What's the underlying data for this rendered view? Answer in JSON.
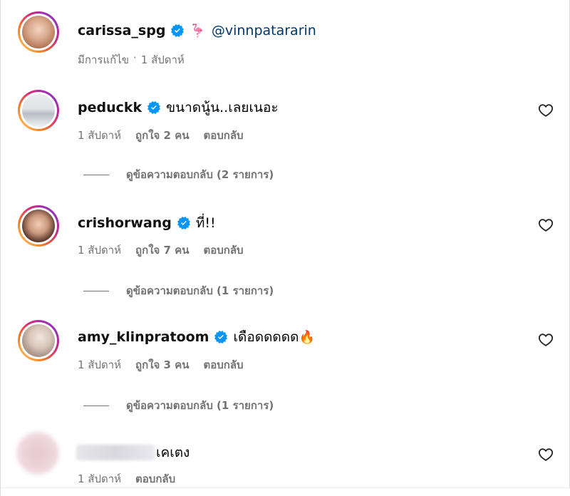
{
  "caption": {
    "username": "carissa_spg",
    "mention": "@vinnpatararin",
    "emoji": "🦩",
    "edited_label": "มีการแก้ไข",
    "separator": "·",
    "time": "1 สัปดาห์"
  },
  "comments": [
    {
      "username": "peduckk",
      "text": "ขนาดนู้น..เลยเนอะ",
      "time": "1 สัปดาห์",
      "likes": "ถูกใจ 2 คน",
      "reply_label": "ตอบกลับ",
      "view_replies": "ดูข้อความตอบกลับ (2 รายการ)"
    },
    {
      "username": "crishorwang",
      "text": "ที่!!",
      "time": "1 สัปดาห์",
      "likes": "ถูกใจ 7 คน",
      "reply_label": "ตอบกลับ",
      "view_replies": "ดูข้อความตอบกลับ (1 รายการ)"
    },
    {
      "username": "amy_klinpratoom",
      "text": "เดือดดดดด",
      "emoji": "🔥",
      "time": "1 สัปดาห์",
      "likes": "ถูกใจ 3 คน",
      "reply_label": "ตอบกลับ",
      "view_replies": "ดูข้อความตอบกลับ (1 รายการ)"
    },
    {
      "username": "",
      "text": "เคเตง",
      "time": "1 สัปดาห์",
      "reply_label": "ตอบกลับ"
    }
  ],
  "colors": {
    "verified_blue": "#0095f6",
    "mention_blue": "#00376b",
    "muted_text": "#737373",
    "avatar_ring": "#d62976"
  },
  "icons": {
    "verified": "verified-badge-icon",
    "like": "heart-outline-icon"
  }
}
